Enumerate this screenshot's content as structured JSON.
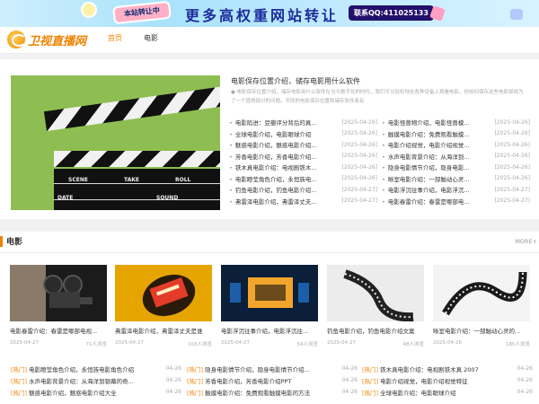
{
  "banner": {
    "sticker": "本站转让中",
    "headline": "更多高权重网站转让",
    "contact": "联系QQ:411025133"
  },
  "header": {
    "logo": "卫视直播网",
    "nav": [
      "首页",
      "电影"
    ]
  },
  "featured": {
    "title": "电影保存位置介绍，储存电影用什么软件",
    "description": "● 电影保存位置介绍，储存电影用什么软件在当今数字化的时代，我们可以轻松地在各种设备上观看电影，但如何保存这些电影却成为了一个值得探讨的问题。不同的电影保存位置和储存软件各有",
    "image_labels": [
      "SCENE",
      "TAKE",
      "ROLL",
      "DATE",
      "SOUND"
    ]
  },
  "news_col1": [
    {
      "t": "电影陷进：豆瓣评分背后的真...",
      "d": "[2025-04-26]"
    },
    {
      "t": "全球电影介绍，电影眼球介绍",
      "d": "[2025-04-26]"
    },
    {
      "t": "魅惑电影介绍，魅惑电影介绍...",
      "d": "[2025-04-26]"
    },
    {
      "t": "芳香电影介绍，芳香电影介绍...",
      "d": "[2025-04-26]"
    },
    {
      "t": "铁木真电影介绍：电视剧铁木...",
      "d": "[2025-04-26]"
    },
    {
      "t": "电影瞪莹角色介绍，永恒族电...",
      "d": "[2025-04-26]"
    },
    {
      "t": "钓鱼电影介绍，钓鱼电影介绍...",
      "d": "[2025-04-27]"
    },
    {
      "t": "弗雷泽电影介绍，弗雷泽丈夫...",
      "d": "[2025-04-27]"
    }
  ],
  "news_col2": [
    {
      "t": "电影怪兽物介绍，电影怪兽模...",
      "d": "[2025-04-26]"
    },
    {
      "t": "触摸电影介绍：免费观看触摸...",
      "d": "[2025-04-26]"
    },
    {
      "t": "电影介绍视觉，电影介绍视觉...",
      "d": "[2025-04-26]"
    },
    {
      "t": "水声电影背景介绍：从海洋到...",
      "d": "[2025-04-26]"
    },
    {
      "t": "隐身电影情节介绍，隐身电影...",
      "d": "[2025-04-26]"
    },
    {
      "t": "晰室电影介绍：一部触动心灵...",
      "d": "[2025-04-26]"
    },
    {
      "t": "电影浮沉往事介绍，电影浮沉...",
      "d": "[2025-04-27]"
    },
    {
      "t": "电影春雷介绍：春雷是哪部电...",
      "d": "[2025-04-27]"
    }
  ],
  "section": {
    "name": "电影",
    "more": "MORE+"
  },
  "cards": [
    {
      "title": "电影春雷介绍：春雷是哪部电视...",
      "date": "2025-04-27",
      "views": "71人浏览"
    },
    {
      "title": "弗雷泽电影介绍，弗雷泽丈夫是谁",
      "date": "2025-04-27",
      "views": "103人浏览"
    },
    {
      "title": "电影浮沉往事介绍，电影浮沉往...",
      "date": "2025-04-27",
      "views": "54人浏览"
    },
    {
      "title": "钓鱼电影介绍，钓鱼电影介绍文案",
      "date": "2025-04-27",
      "views": "48人浏览"
    },
    {
      "title": "晰室电影介绍：一部触动心灵的...",
      "date": "2025-04-26",
      "views": "185人浏览"
    }
  ],
  "bottom": [
    [
      {
        "tag": "[热门]",
        "t": "电影瞪莹角色介绍，永恒族电影角色介绍",
        "d": "04-26"
      },
      {
        "tag": "[热门]",
        "t": "水声电影背景介绍：从海洋到银幕的奇...",
        "d": "04-26"
      },
      {
        "tag": "[热门]",
        "t": "魅惑电影介绍，魅惑电影介绍大全",
        "d": "04-26"
      }
    ],
    [
      {
        "tag": "[热门]",
        "t": "隐身电影情节介绍，隐身电影情节介绍...",
        "d": "04-26"
      },
      {
        "tag": "[热门]",
        "t": "芳香电影介绍，芳香电影介绍PPT",
        "d": "04-26"
      },
      {
        "tag": "[热门]",
        "t": "触摸电影介绍：免费观看触摸电影的方法",
        "d": "04-26"
      }
    ],
    [
      {
        "tag": "[热门]",
        "t": "铁木真电影介绍：电视剧铁木真 2007",
        "d": "04-26"
      },
      {
        "tag": "[热门]",
        "t": "电影介绍视觉，电影介绍视觉特征",
        "d": "04-26"
      },
      {
        "tag": "[热门]",
        "t": "全球电影介绍：电影眼球介绍",
        "d": "04-26"
      }
    ]
  ],
  "colors": {
    "accent": "#f08300",
    "banner_bg": "#bfe9ff",
    "contact_bg": "#22106d"
  }
}
